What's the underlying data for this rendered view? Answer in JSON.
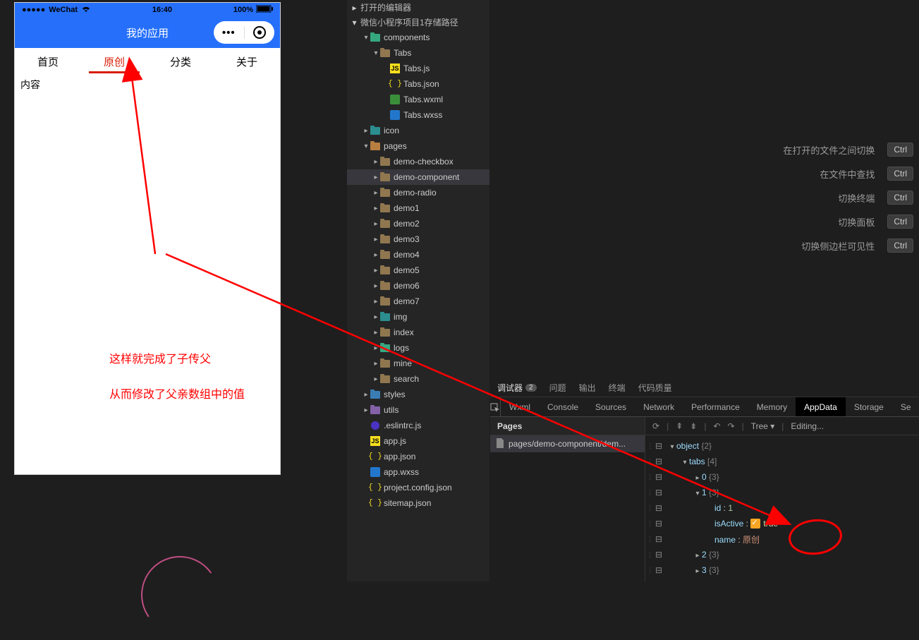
{
  "simulator": {
    "statusbar": {
      "carrier_dots": "●●●●●",
      "carrier": "WeChat",
      "wifi_icon": "wifi-icon",
      "time": "16:40",
      "battery_pct": "100%"
    },
    "nav_title": "我的应用",
    "tabs": [
      {
        "label": "首页",
        "active": false
      },
      {
        "label": "原创",
        "active": true
      },
      {
        "label": "分类",
        "active": false
      },
      {
        "label": "关于",
        "active": false
      }
    ],
    "content_text": "内容"
  },
  "annotations": {
    "line1": "这样就完成了子传父",
    "line2": "从而修改了父亲数组中的值"
  },
  "explorer": {
    "section1": "打开的编辑器",
    "section2": "微信小程序项目1存储路径",
    "tree": [
      {
        "depth": 1,
        "tw": "▾",
        "icoClass": "ico-folder green",
        "label": "components"
      },
      {
        "depth": 2,
        "tw": "▾",
        "icoClass": "ico-folder",
        "label": "Tabs"
      },
      {
        "depth": 3,
        "tw": "",
        "icoClass": "ico-js",
        "icoText": "JS",
        "label": "Tabs.js"
      },
      {
        "depth": 3,
        "tw": "",
        "icoClass": "ico-json",
        "icoText": "{ }",
        "label": "Tabs.json"
      },
      {
        "depth": 3,
        "tw": "",
        "icoClass": "ico-wxml",
        "icoText": "",
        "label": "Tabs.wxml"
      },
      {
        "depth": 3,
        "tw": "",
        "icoClass": "ico-wxss",
        "icoText": "",
        "label": "Tabs.wxss"
      },
      {
        "depth": 1,
        "tw": "▸",
        "icoClass": "ico-folder teal",
        "label": "icon"
      },
      {
        "depth": 1,
        "tw": "▾",
        "icoClass": "ico-folder orange",
        "label": "pages"
      },
      {
        "depth": 2,
        "tw": "▸",
        "icoClass": "ico-folder",
        "label": "demo-checkbox"
      },
      {
        "depth": 2,
        "tw": "▸",
        "icoClass": "ico-folder",
        "label": "demo-component",
        "selected": true
      },
      {
        "depth": 2,
        "tw": "▸",
        "icoClass": "ico-folder",
        "label": "demo-radio"
      },
      {
        "depth": 2,
        "tw": "▸",
        "icoClass": "ico-folder",
        "label": "demo1"
      },
      {
        "depth": 2,
        "tw": "▸",
        "icoClass": "ico-folder",
        "label": "demo2"
      },
      {
        "depth": 2,
        "tw": "▸",
        "icoClass": "ico-folder",
        "label": "demo3"
      },
      {
        "depth": 2,
        "tw": "▸",
        "icoClass": "ico-folder",
        "label": "demo4"
      },
      {
        "depth": 2,
        "tw": "▸",
        "icoClass": "ico-folder",
        "label": "demo5"
      },
      {
        "depth": 2,
        "tw": "▸",
        "icoClass": "ico-folder",
        "label": "demo6"
      },
      {
        "depth": 2,
        "tw": "▸",
        "icoClass": "ico-folder",
        "label": "demo7"
      },
      {
        "depth": 2,
        "tw": "▸",
        "icoClass": "ico-folder teal",
        "label": "img"
      },
      {
        "depth": 2,
        "tw": "▸",
        "icoClass": "ico-folder",
        "label": "index"
      },
      {
        "depth": 2,
        "tw": "▸",
        "icoClass": "ico-folder green",
        "label": "logs"
      },
      {
        "depth": 2,
        "tw": "▸",
        "icoClass": "ico-folder",
        "label": "mine"
      },
      {
        "depth": 2,
        "tw": "▸",
        "icoClass": "ico-folder",
        "label": "search"
      },
      {
        "depth": 1,
        "tw": "▸",
        "icoClass": "ico-folder blue",
        "label": "styles"
      },
      {
        "depth": 1,
        "tw": "▸",
        "icoClass": "ico-folder purple",
        "label": "utils"
      },
      {
        "depth": 1,
        "tw": "",
        "icoClass": "ico-eslint",
        "label": ".eslintrc.js"
      },
      {
        "depth": 1,
        "tw": "",
        "icoClass": "ico-js",
        "icoText": "JS",
        "label": "app.js"
      },
      {
        "depth": 1,
        "tw": "",
        "icoClass": "ico-json",
        "icoText": "{ }",
        "label": "app.json"
      },
      {
        "depth": 1,
        "tw": "",
        "icoClass": "ico-wxss",
        "label": "app.wxss"
      },
      {
        "depth": 1,
        "tw": "",
        "icoClass": "ico-json",
        "icoText": "{ }",
        "label": "project.config.json"
      },
      {
        "depth": 1,
        "tw": "",
        "icoClass": "ico-json",
        "icoText": "{ }",
        "label": "sitemap.json"
      }
    ]
  },
  "hints": [
    {
      "label": "在打开的文件之间切换",
      "key": "Ctrl"
    },
    {
      "label": "在文件中查找",
      "key": "Ctrl"
    },
    {
      "label": "切换终端",
      "key": "Ctrl"
    },
    {
      "label": "切换面板",
      "key": "Ctrl"
    },
    {
      "label": "切换侧边栏可见性",
      "key": "Ctrl"
    }
  ],
  "devtools": {
    "toptabs": [
      {
        "label": "调试器",
        "badge": "2",
        "active": true
      },
      {
        "label": "问题"
      },
      {
        "label": "输出"
      },
      {
        "label": "终端"
      },
      {
        "label": "代码质量"
      }
    ],
    "subtabs": [
      "Wxml",
      "Console",
      "Sources",
      "Network",
      "Performance",
      "Memory",
      "AppData",
      "Storage",
      "Se"
    ],
    "active_subtab": "AppData",
    "pages_header": "Pages",
    "page_item": "pages/demo-component/dem...",
    "toolbar": {
      "tree_label": "Tree",
      "editing": "Editing..."
    },
    "data_rows": [
      {
        "indent": 0,
        "tw": "▾",
        "content": [
          {
            "t": "key",
            "v": "object"
          },
          {
            "t": "punc",
            "v": " "
          },
          {
            "t": "meta",
            "v": "{2}"
          }
        ]
      },
      {
        "indent": 1,
        "tw": "▾",
        "content": [
          {
            "t": "key",
            "v": "tabs"
          },
          {
            "t": "punc",
            "v": " "
          },
          {
            "t": "meta",
            "v": "[4]"
          }
        ]
      },
      {
        "indent": 2,
        "tw": "▸",
        "content": [
          {
            "t": "key",
            "v": "0"
          },
          {
            "t": "punc",
            "v": " "
          },
          {
            "t": "meta",
            "v": "{3}"
          }
        ]
      },
      {
        "indent": 2,
        "tw": "▾",
        "content": [
          {
            "t": "key",
            "v": "1"
          },
          {
            "t": "punc",
            "v": " "
          },
          {
            "t": "meta",
            "v": "{3}"
          }
        ]
      },
      {
        "indent": 3,
        "tw": "",
        "content": [
          {
            "t": "key",
            "v": "id"
          },
          {
            "t": "punc",
            "v": " : "
          },
          {
            "t": "num",
            "v": "1"
          }
        ]
      },
      {
        "indent": 3,
        "tw": "",
        "content": [
          {
            "t": "key",
            "v": "isActive"
          },
          {
            "t": "punc",
            "v": " : "
          },
          {
            "t": "chk"
          },
          {
            "t": "bool",
            "v": "true"
          }
        ]
      },
      {
        "indent": 3,
        "tw": "",
        "content": [
          {
            "t": "key",
            "v": "name"
          },
          {
            "t": "punc",
            "v": " : "
          },
          {
            "t": "str",
            "v": "原创"
          }
        ]
      },
      {
        "indent": 2,
        "tw": "▸",
        "content": [
          {
            "t": "key",
            "v": "2"
          },
          {
            "t": "punc",
            "v": " "
          },
          {
            "t": "meta",
            "v": "{3}"
          }
        ]
      },
      {
        "indent": 2,
        "tw": "▸",
        "content": [
          {
            "t": "key",
            "v": "3"
          },
          {
            "t": "punc",
            "v": " "
          },
          {
            "t": "meta",
            "v": "{3}"
          }
        ]
      }
    ]
  }
}
